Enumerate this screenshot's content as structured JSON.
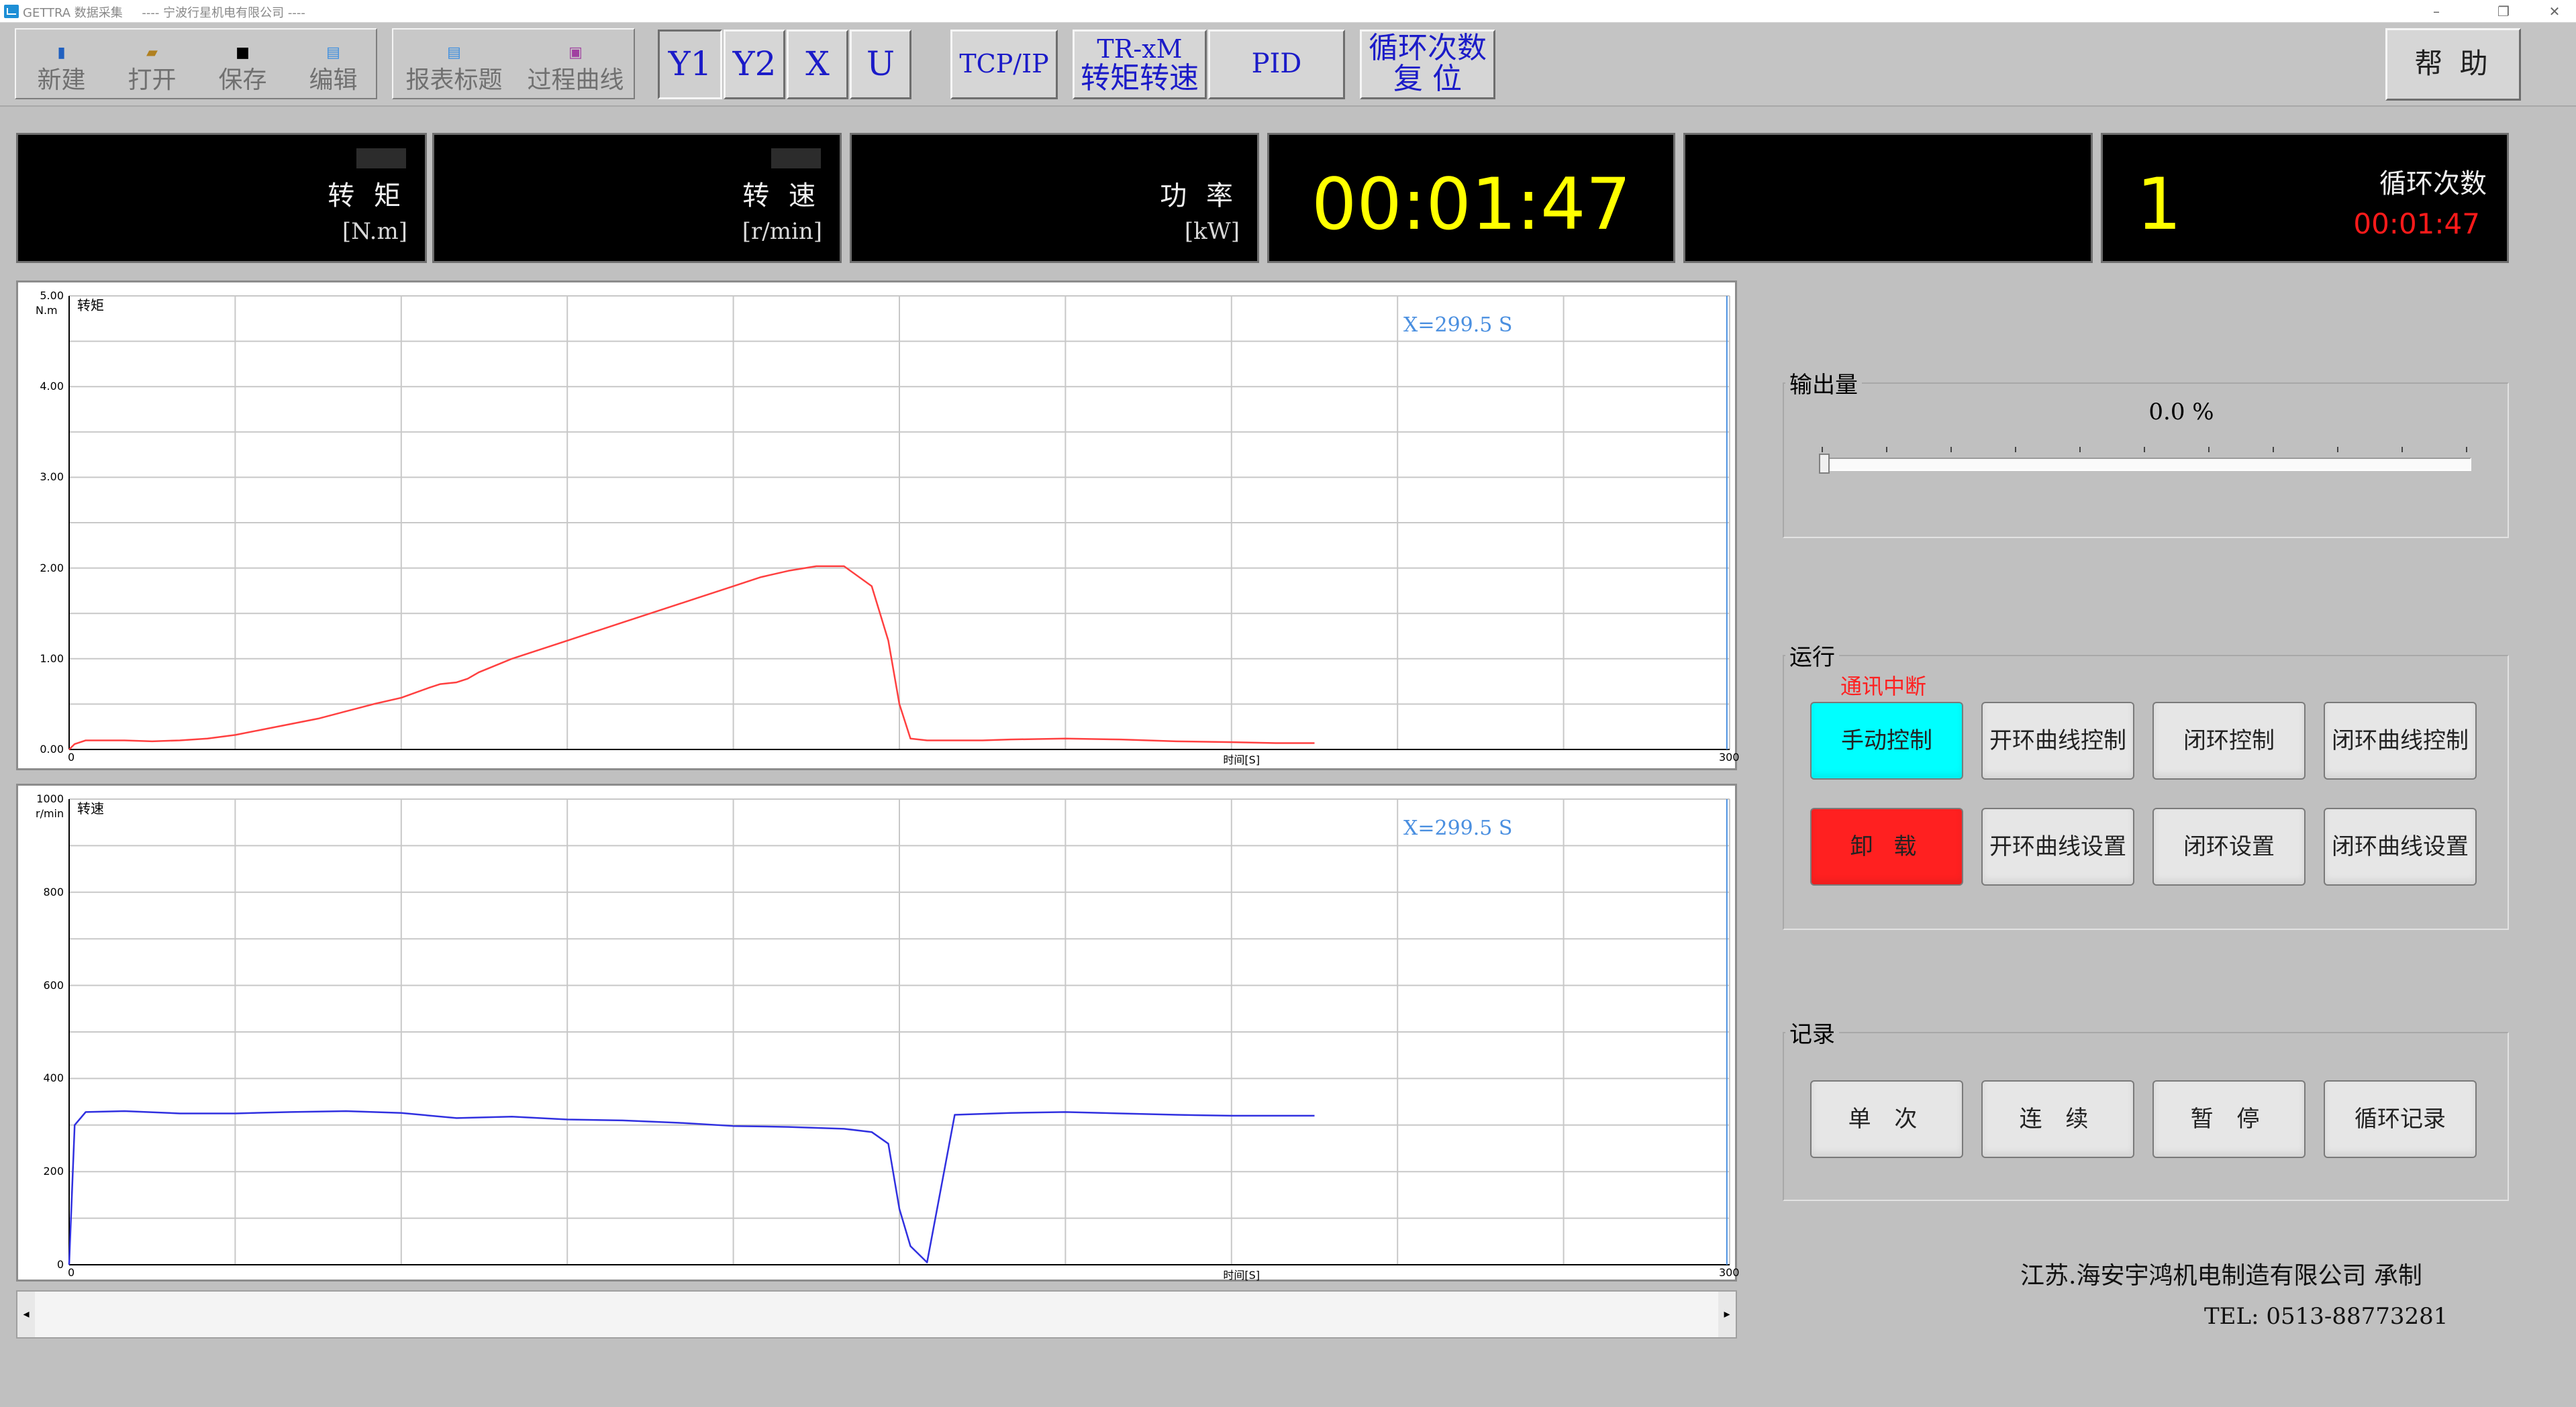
{
  "window": {
    "title": "GETTRA 数据采集",
    "subtitle": "---- 宁波行星机电有限公司 ----",
    "controls": [
      "–",
      "❐",
      "✕"
    ]
  },
  "toolbar": {
    "file_items": [
      {
        "label": "新建",
        "icon": "new-file-icon"
      },
      {
        "label": "打开",
        "icon": "open-folder-icon"
      },
      {
        "label": "保存",
        "icon": "save-disk-icon"
      },
      {
        "label": "编辑",
        "icon": "edit-icon"
      }
    ],
    "report_items": [
      {
        "label": "报表标题",
        "icon": "report-icon"
      },
      {
        "label": "过程曲线",
        "icon": "curve-icon"
      }
    ],
    "axis_buttons": [
      "Y1",
      "Y2",
      "X",
      "U"
    ],
    "tcpip": "TCP/IP",
    "tr_line1": "TR-xM",
    "tr_line2": "转矩转速",
    "pid": "PID",
    "cycle_reset_line1": "循环次数",
    "cycle_reset_line2": "复 位",
    "help": "帮 助"
  },
  "panels": {
    "torque_label": "转 矩",
    "torque_unit": "[N.m]",
    "speed_label": "转 速",
    "speed_unit": "[r/min]",
    "power_label": "功 率",
    "power_unit": "[kW]",
    "elapsed": "00:01:47",
    "cycle_count": "1",
    "cycle_label": "循环次数",
    "cycle_time": "00:01:47"
  },
  "colors": {
    "torque_line": "#ff4040",
    "speed_line": "#3030e0",
    "display_text": "#ffff00",
    "cycle_time": "#ff1a1a",
    "comm_status": "#ff2020",
    "manual_active": "#00ffff",
    "unload": "#ff2020"
  },
  "chart_data": [
    {
      "type": "line",
      "title": "转矩",
      "ylabel": "N.m",
      "xlabel": "时间[S]",
      "ylim": [
        0,
        5
      ],
      "xlim": [
        0,
        300
      ],
      "yticks": [
        "0.00",
        "1.00",
        "2.00",
        "3.00",
        "4.00",
        "5.00"
      ],
      "xticks": [
        "0",
        "300"
      ],
      "cursor": "X=299.5 S",
      "grid": true,
      "series": [
        {
          "x": [
            0,
            1,
            3,
            6,
            10,
            15,
            20,
            25,
            30,
            35,
            40,
            45,
            50,
            55,
            60,
            65,
            67,
            70,
            72,
            74,
            76,
            78,
            80,
            85,
            90,
            95,
            100,
            105,
            110,
            115,
            120,
            125,
            130,
            135,
            140,
            145,
            148,
            150,
            152,
            155,
            160,
            165,
            170,
            180,
            190,
            200,
            210,
            218,
            225
          ],
          "y": [
            0.0,
            0.06,
            0.1,
            0.1,
            0.1,
            0.09,
            0.1,
            0.12,
            0.16,
            0.22,
            0.28,
            0.34,
            0.42,
            0.5,
            0.57,
            0.68,
            0.72,
            0.74,
            0.78,
            0.85,
            0.9,
            0.95,
            1.0,
            1.1,
            1.2,
            1.3,
            1.4,
            1.5,
            1.6,
            1.7,
            1.8,
            1.9,
            1.97,
            2.02,
            2.02,
            1.8,
            1.2,
            0.5,
            0.12,
            0.1,
            0.1,
            0.1,
            0.11,
            0.12,
            0.11,
            0.09,
            0.08,
            0.07,
            0.07
          ]
        }
      ]
    },
    {
      "type": "line",
      "title": "转速",
      "ylabel": "r/min",
      "xlabel": "时间[S]",
      "ylim": [
        0,
        1000
      ],
      "xlim": [
        0,
        300
      ],
      "yticks": [
        "0",
        "200",
        "400",
        "600",
        "800",
        "1000"
      ],
      "xticks": [
        "0",
        "300"
      ],
      "cursor": "X=299.5 S",
      "grid": true,
      "series": [
        {
          "x": [
            0,
            1,
            3,
            10,
            20,
            30,
            40,
            50,
            60,
            70,
            80,
            90,
            100,
            110,
            120,
            130,
            140,
            145,
            148,
            150,
            152,
            155,
            160,
            170,
            180,
            190,
            200,
            210,
            225
          ],
          "y": [
            0,
            300,
            328,
            330,
            325,
            325,
            328,
            330,
            326,
            315,
            318,
            312,
            310,
            305,
            298,
            296,
            292,
            285,
            260,
            120,
            40,
            5,
            322,
            326,
            328,
            325,
            322,
            320,
            320
          ]
        }
      ]
    }
  ],
  "output": {
    "label": "输出量",
    "value": "0.0 %",
    "level_percent": 0
  },
  "run": {
    "label": "运行",
    "status": "通讯中断",
    "buttons_row1": [
      "手动控制",
      "开环曲线控制",
      "闭环控制",
      "闭环曲线控制"
    ],
    "buttons_row2": [
      "卸 载",
      "开环曲线设置",
      "闭环设置",
      "闭环曲线设置"
    ]
  },
  "record": {
    "label": "记录",
    "buttons": [
      "单 次",
      "连 续",
      "暂 停",
      "循环记录"
    ]
  },
  "footer": {
    "company": "江苏.海安宇鸿机电制造有限公司 承制",
    "tel": "TEL: 0513-88773281"
  }
}
